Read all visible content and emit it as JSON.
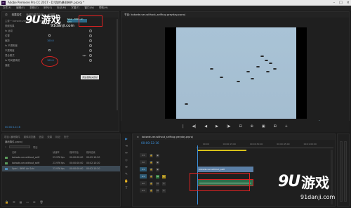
{
  "window": {
    "title": "Adobe Premiere Pro CC 2017 - D:\\我的\\暴雨降件.prproj *",
    "logo": "Pr"
  },
  "menu": [
    "文件(F)",
    "编辑(E)",
    "剪辑(C)",
    "序列(S)",
    "标记(M)",
    "字幕(T)",
    "窗口(W)",
    "帮助(H)"
  ],
  "effect_controls": {
    "tabs": [
      "源",
      "效果控件",
      "音频剪辑混合器",
      "元数据"
    ],
    "clip_name": "主要 * kokwde-ver-without_selfie",
    "sequence_label": "Spiel - 8695 An Schi",
    "rows": [
      {
        "label": "视频效果",
        "value": ""
      },
      {
        "label": "fx 运动",
        "value": ""
      },
      {
        "label": "位置",
        "value": ""
      },
      {
        "label": "缩放",
        "value": "100.0"
      },
      {
        "label": "fx 不透明度",
        "value": ""
      },
      {
        "label": "不透明度",
        "value": ""
      },
      {
        "label": "混合模式",
        "value": ""
      },
      {
        "label": "fx 时间重映射",
        "value": "100.0"
      },
      {
        "label": "速度",
        "value": ""
      }
    ],
    "tooltip": "添加/删除关键帧",
    "timecode": "00:00:12:16"
  },
  "program_monitor": {
    "tab": "节目: kokwde-ver-without_selfhug greyday.prproj",
    "timecode_left": "00:00:12:16",
    "fit": "适合",
    "full": "完整",
    "timecode_right": "00:02:10:20"
  },
  "transport": [
    "|",
    "◀|",
    "◀",
    "▶",
    "|▶",
    "⊟",
    "⊕",
    "▣",
    "⊞",
    "+"
  ],
  "project": {
    "tabs": [
      "项目: 暴雨降件",
      "媒体浏览器",
      "信息",
      "效果",
      "标记",
      "历史"
    ],
    "name": "暴雨降件.prproj",
    "search_label": "项目",
    "columns": [
      "",
      "名称",
      "帧速率",
      "媒体开始",
      "媒体结束"
    ],
    "rows": [
      {
        "name": "kokwde-ver-without_selfi",
        "fps": "23.976 fps",
        "start": "00:00:00:00",
        "end": "00:02:10:20",
        "color": "#5b9b5b"
      },
      {
        "name": "kokwde-ver-without_selfi",
        "fps": "23.976 fps",
        "start": "00:00:00:00",
        "end": "00:02:10:20",
        "color": "#5b9b5b"
      },
      {
        "name": "Spiel - 8695 An Schi",
        "fps": "23.976 fps",
        "start": "00:00:00:00",
        "end": "00:02:10:20",
        "color": "#4d8ab6"
      }
    ]
  },
  "timeline": {
    "tab": "kokwde-ver-without_selfhug greyday.prproj",
    "timecode": "00:00:12:16",
    "ruler": [
      "00:00",
      "00:00:15:00",
      "00:00:30:00",
      "00:00:45:00",
      "00:01:00:00"
    ],
    "tracks": [
      "V3",
      "V2",
      "V1",
      "A1",
      "A2",
      "A3"
    ],
    "video_clip": "kokwde-ver-without_selfi"
  },
  "watermark": {
    "logo": "9U",
    "text": "游戏",
    "url": "91danji.com"
  }
}
